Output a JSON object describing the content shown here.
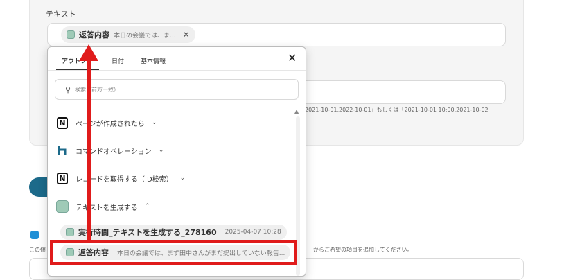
{
  "form": {
    "text_label": "テキスト",
    "chip": {
      "name": "返答内容",
      "preview": "本日の会議では、ま..."
    },
    "hint_text": "2021-10-01,2022-10-01」もしくは「2021-10-01 10:00,2021-10-02",
    "lower_hint": "この値",
    "lower_hint_right": "からご希望の項目を追加してください。"
  },
  "dropdown": {
    "tabs": [
      "アウトプ",
      "日付",
      "基本情報"
    ],
    "search_placeholder": "検索（前方一致）",
    "sections": [
      {
        "label": "ページが作成されたら",
        "chev": "⌄"
      },
      {
        "label": "コマンドオペレーション",
        "chev": "⌄"
      },
      {
        "label": "レコードを取得する（ID検索）",
        "chev": "⌄"
      },
      {
        "label": "テキストを生成する",
        "chev": "⌃"
      }
    ],
    "items": [
      {
        "name": "実行時間_テキストを生成する_278160",
        "value": "2025-04-07 10:28"
      },
      {
        "name": "返答内容",
        "value": "本日の会議では、まず田中さんがまだ提出していない報告..."
      }
    ]
  },
  "colors": {
    "highlight": "#e01b1b",
    "accent_button": "#1c6a8a"
  }
}
